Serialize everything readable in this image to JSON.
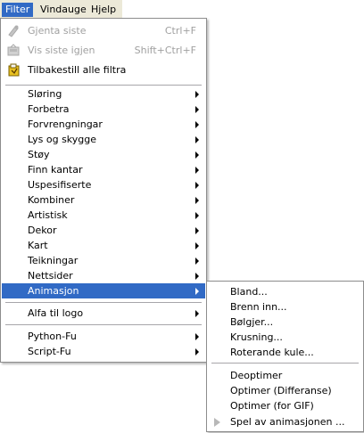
{
  "menubar": {
    "filter": "Filter",
    "windows": "Vindauge",
    "help": "Hjelp"
  },
  "filter_menu": {
    "repeat_last": {
      "label": "Gjenta siste",
      "accel": "Ctrl+F"
    },
    "reshow_last": {
      "label": "Vis siste igjen",
      "accel": "Shift+Ctrl+F"
    },
    "reset_all": "Tilbakestill alle filtra",
    "categories": [
      "Sløring",
      "Forbetra",
      "Forvrengningar",
      "Lys og skygge",
      "Støy",
      "Finn kantar",
      "Uspesifiserte",
      "Kombiner",
      "Artistisk",
      "Dekor",
      "Kart",
      "Teikningar",
      "Nettsider",
      "Animasjon"
    ],
    "alpha_to_logo": "Alfa til logo",
    "python_fu": "Python-Fu",
    "script_fu": "Script-Fu"
  },
  "animation_menu": {
    "blend": "Bland...",
    "burn_in": "Brenn inn...",
    "waves": "Bølgjer...",
    "ripple": "Krusning...",
    "rotating_globe": "Roterande kule...",
    "unoptimize": "Deoptimer",
    "optimize_diff": "Optimer (Differanse)",
    "optimize_gif": "Optimer (for GIF)",
    "playback": "Spel av animasjonen ..."
  }
}
